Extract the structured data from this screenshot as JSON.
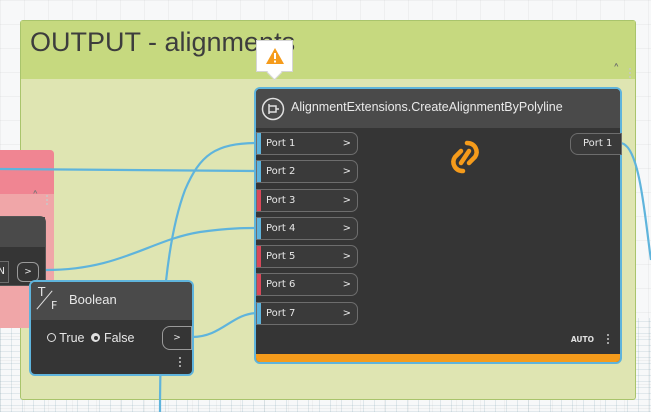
{
  "group": {
    "title": "OUTPUT - alignments"
  },
  "main_node": {
    "title": "AlignmentExtensions.CreateAlignmentByPolyline",
    "inputs": [
      {
        "label": "Port 1",
        "bar_color": "#5fb4dc"
      },
      {
        "label": "Port 2",
        "bar_color": "#5fb4dc"
      },
      {
        "label": "Port 3",
        "bar_color": "#d9485a"
      },
      {
        "label": "Port 4",
        "bar_color": "#5fb4dc"
      },
      {
        "label": "Port 5",
        "bar_color": "#d9485a"
      },
      {
        "label": "Port 6",
        "bar_color": "#d9485a"
      },
      {
        "label": "Port 7",
        "bar_color": "#5fb4dc"
      }
    ],
    "output": "Port 1",
    "lacing": "AUTO",
    "connector_symbol": ">",
    "warning_icon": "warning-triangle-icon",
    "center_icon": "broken-link-icon",
    "accent_color": "#f59b1b"
  },
  "boolean_node": {
    "title": "Boolean",
    "icon_top": "T",
    "icon_bottom": "F",
    "option_true": "True",
    "option_false": "False",
    "selected": "False",
    "connector_symbol": ">"
  },
  "partial_node": {
    "output_letter": "N",
    "connector_symbol": ">"
  },
  "colors": {
    "group_bg": "#dfe5b2",
    "group_header": "#c6d97f",
    "wire": "#5fb4dc",
    "node_bg": "#353535",
    "warning": "#f59b1b",
    "pink_group": "#f0a6a8"
  }
}
